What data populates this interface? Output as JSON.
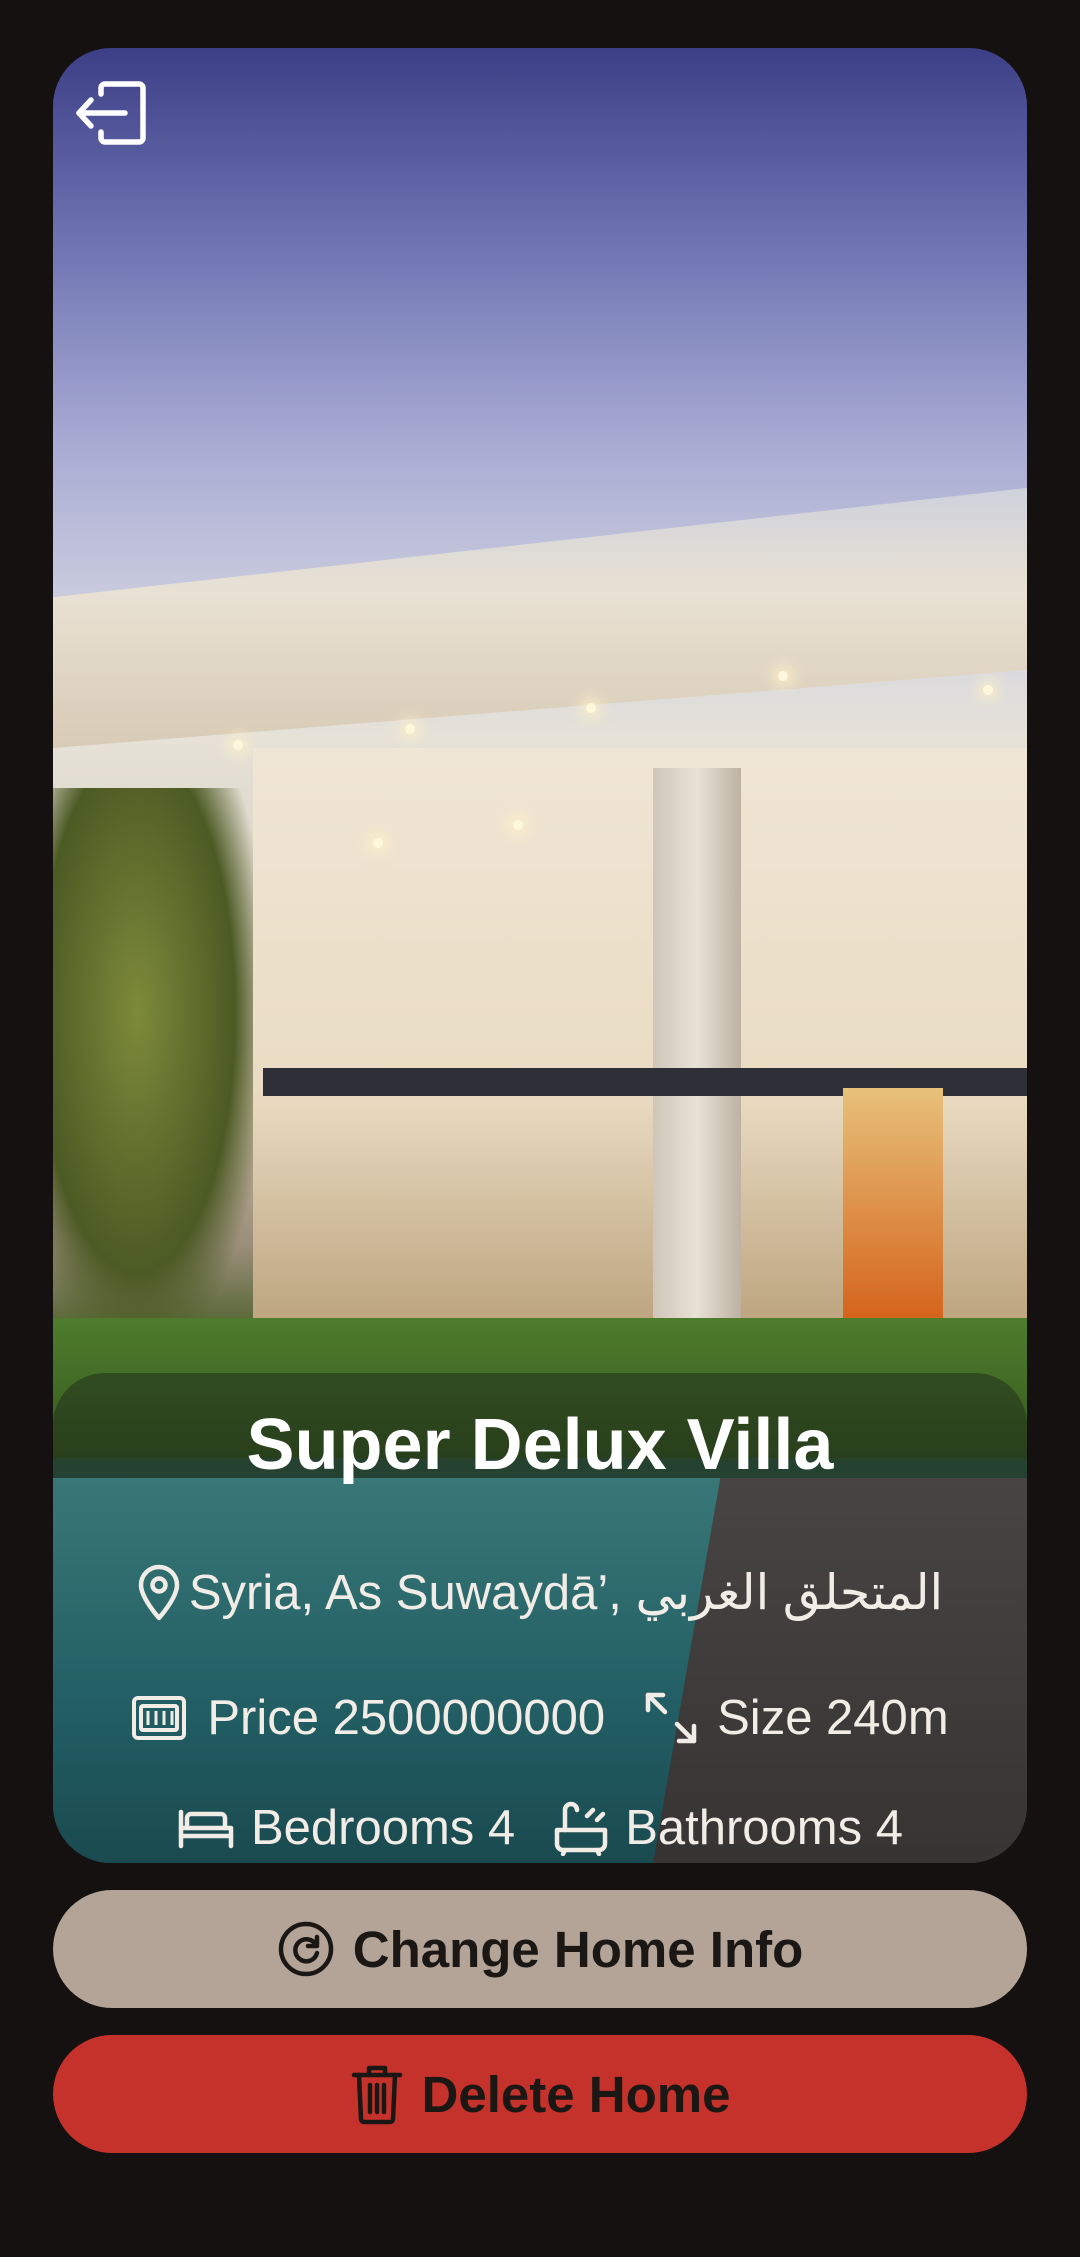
{
  "home": {
    "title": "Super Delux Villa",
    "location": "Syria, As Suwaydā’, المتحلق الغربي",
    "price_text": "Price 2500000000",
    "size_text": "Size 240m",
    "bedrooms_text": "Bedrooms 4",
    "bathrooms_text": "Bathrooms 4"
  },
  "actions": {
    "change_label": "Change Home Info",
    "delete_label": "Delete Home"
  },
  "icons": {
    "exit": "logout-icon",
    "location": "location-pin-icon",
    "price": "money-icon",
    "size": "resize-arrows-icon",
    "bedrooms": "bed-icon",
    "bathrooms": "bathtub-icon",
    "change": "refresh-icon",
    "delete": "trash-icon"
  },
  "colors": {
    "background": "#141110",
    "change_button": "#b3a497",
    "delete_button": "#c4322b",
    "text_light": "#ffffff"
  }
}
